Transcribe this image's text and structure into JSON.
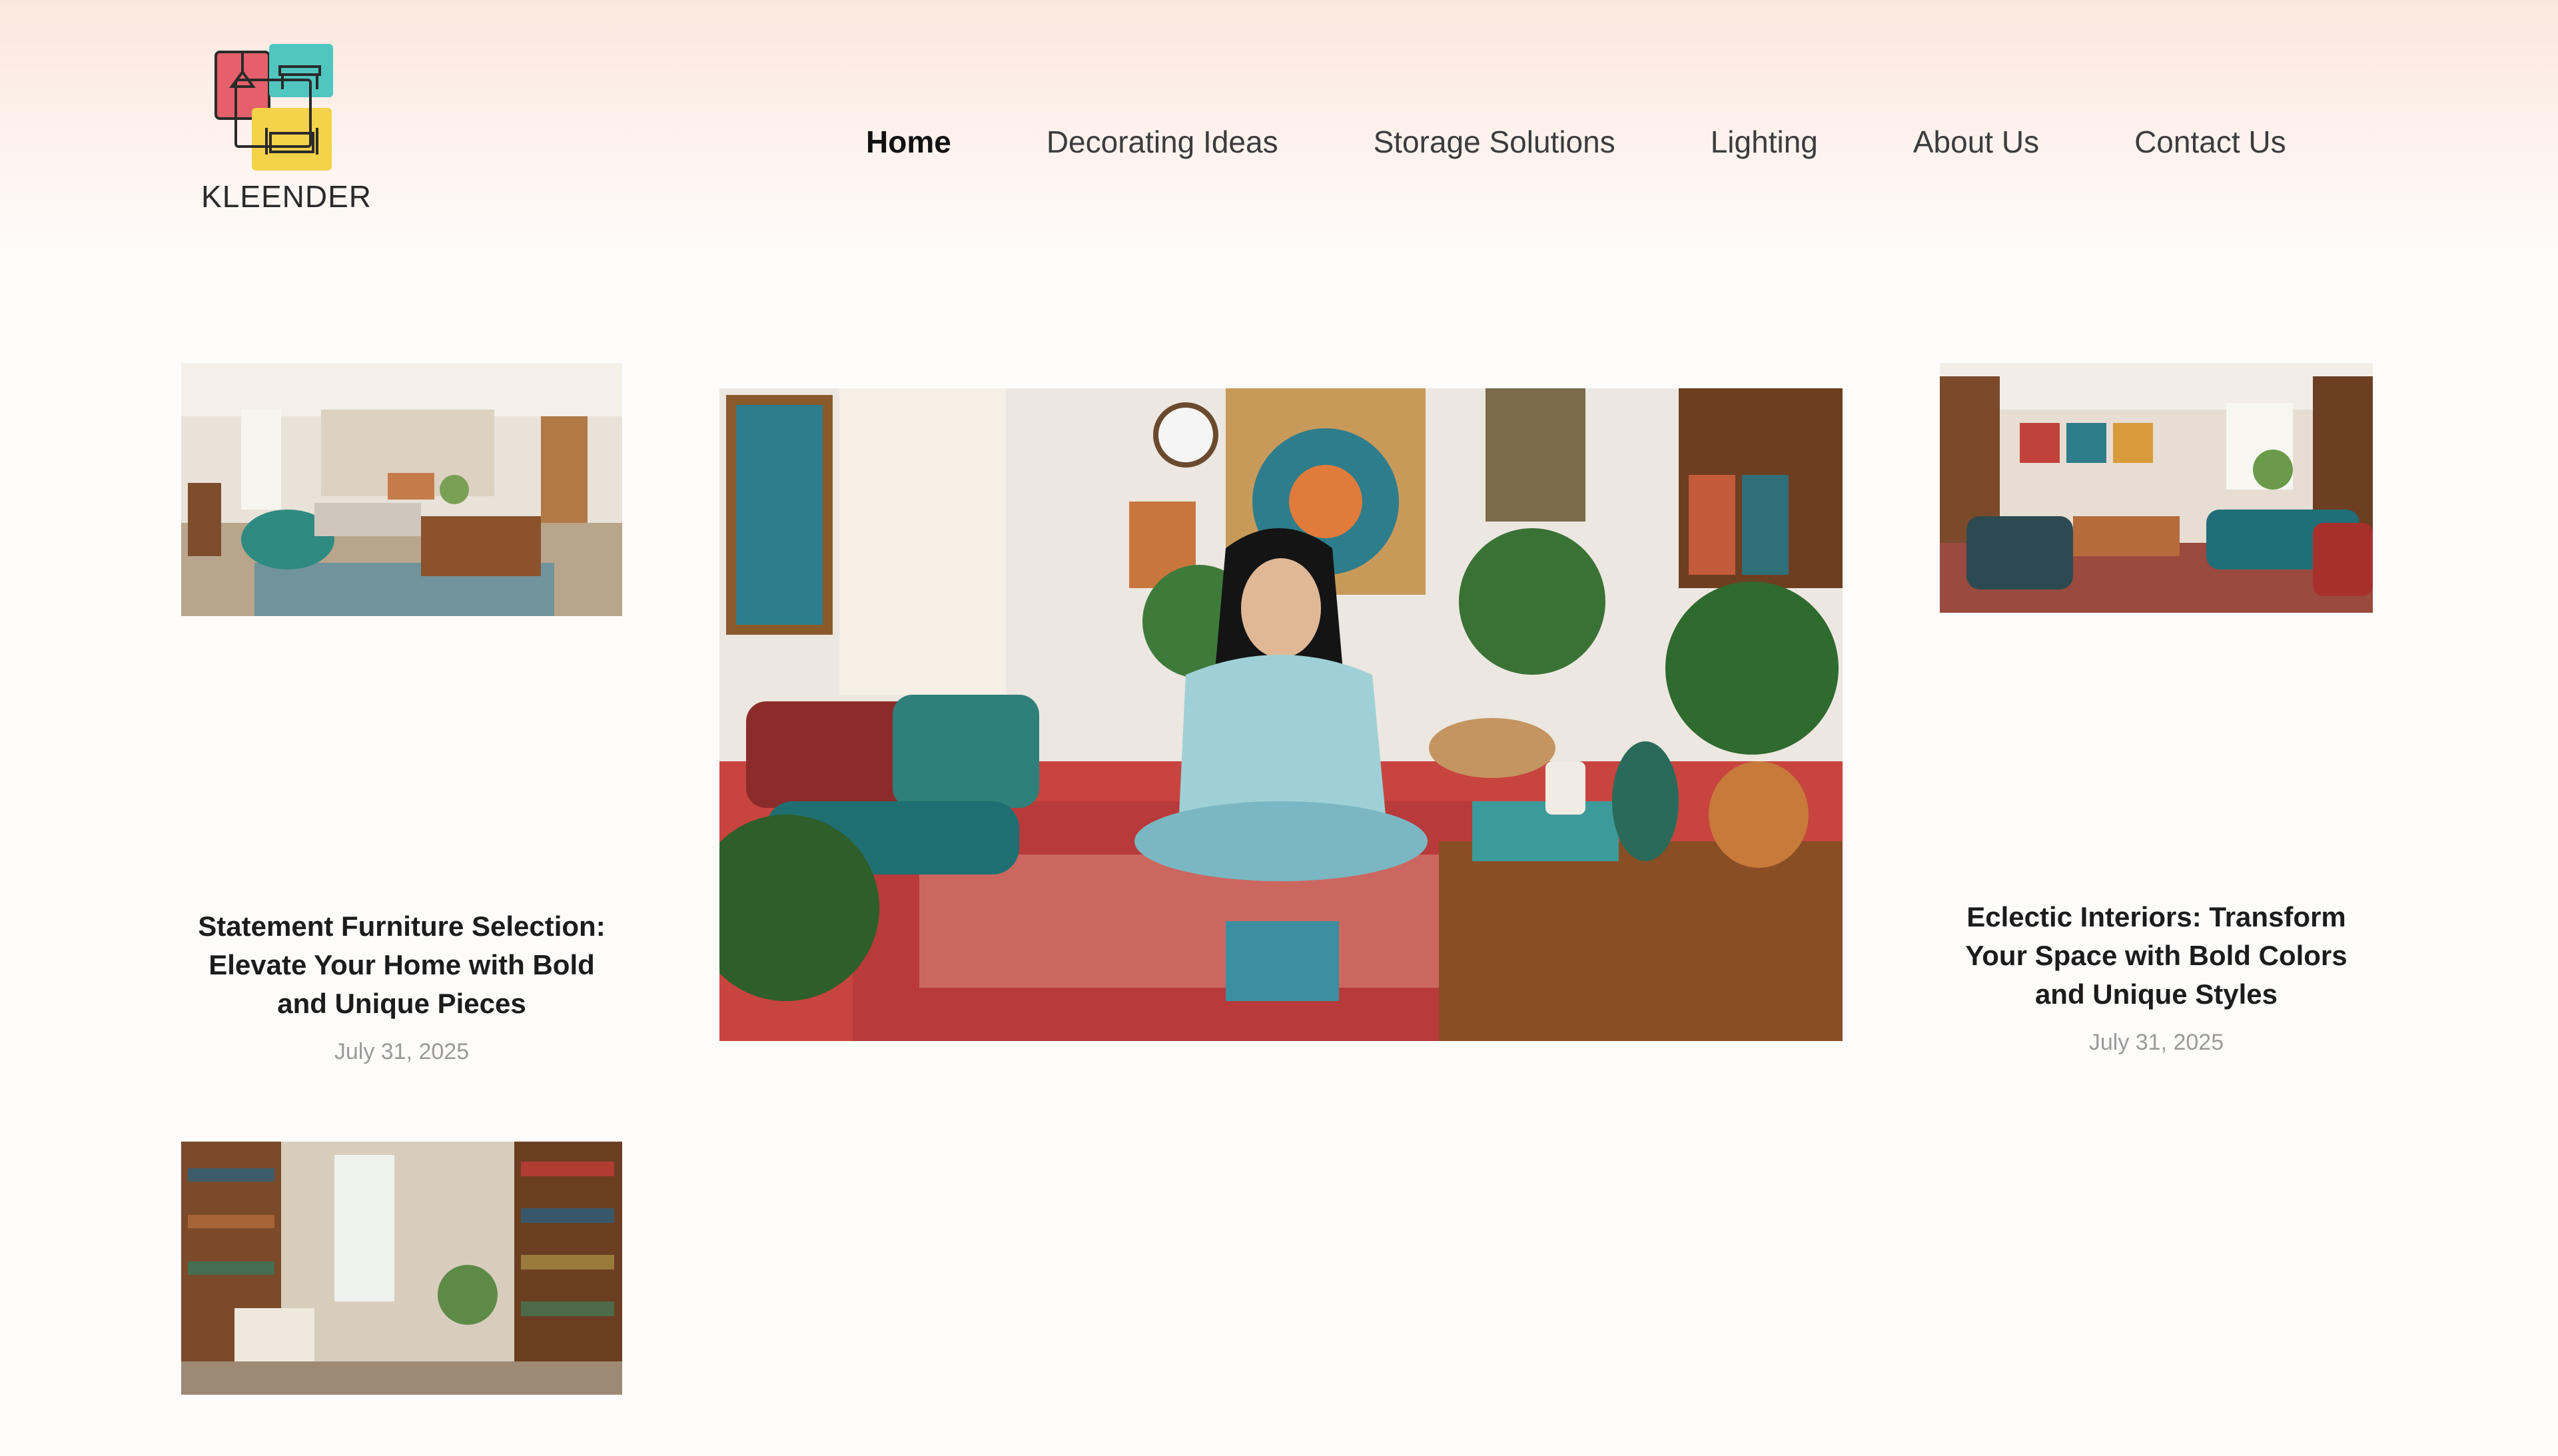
{
  "site": {
    "brand": "KLEENDER",
    "logo_icon": "furniture-logo-icon",
    "accent_colors": [
      "#e5606a",
      "#4fc6c0",
      "#f4d24a"
    ]
  },
  "nav": {
    "items": [
      {
        "label": "Home",
        "active": true
      },
      {
        "label": "Decorating Ideas",
        "active": false
      },
      {
        "label": "Storage Solutions",
        "active": false
      },
      {
        "label": "Lighting",
        "active": false
      },
      {
        "label": "About Us",
        "active": false
      },
      {
        "label": "Contact Us",
        "active": false
      }
    ]
  },
  "posts": {
    "left": {
      "title": "Statement Furniture Selection: Elevate Your Home with Bold and Unique Pieces",
      "date": "July 31, 2025"
    },
    "right": {
      "title": "Eclectic Interiors: Transform Your Space with Bold Colors and Unique Styles",
      "date": "July 31, 2025"
    }
  }
}
